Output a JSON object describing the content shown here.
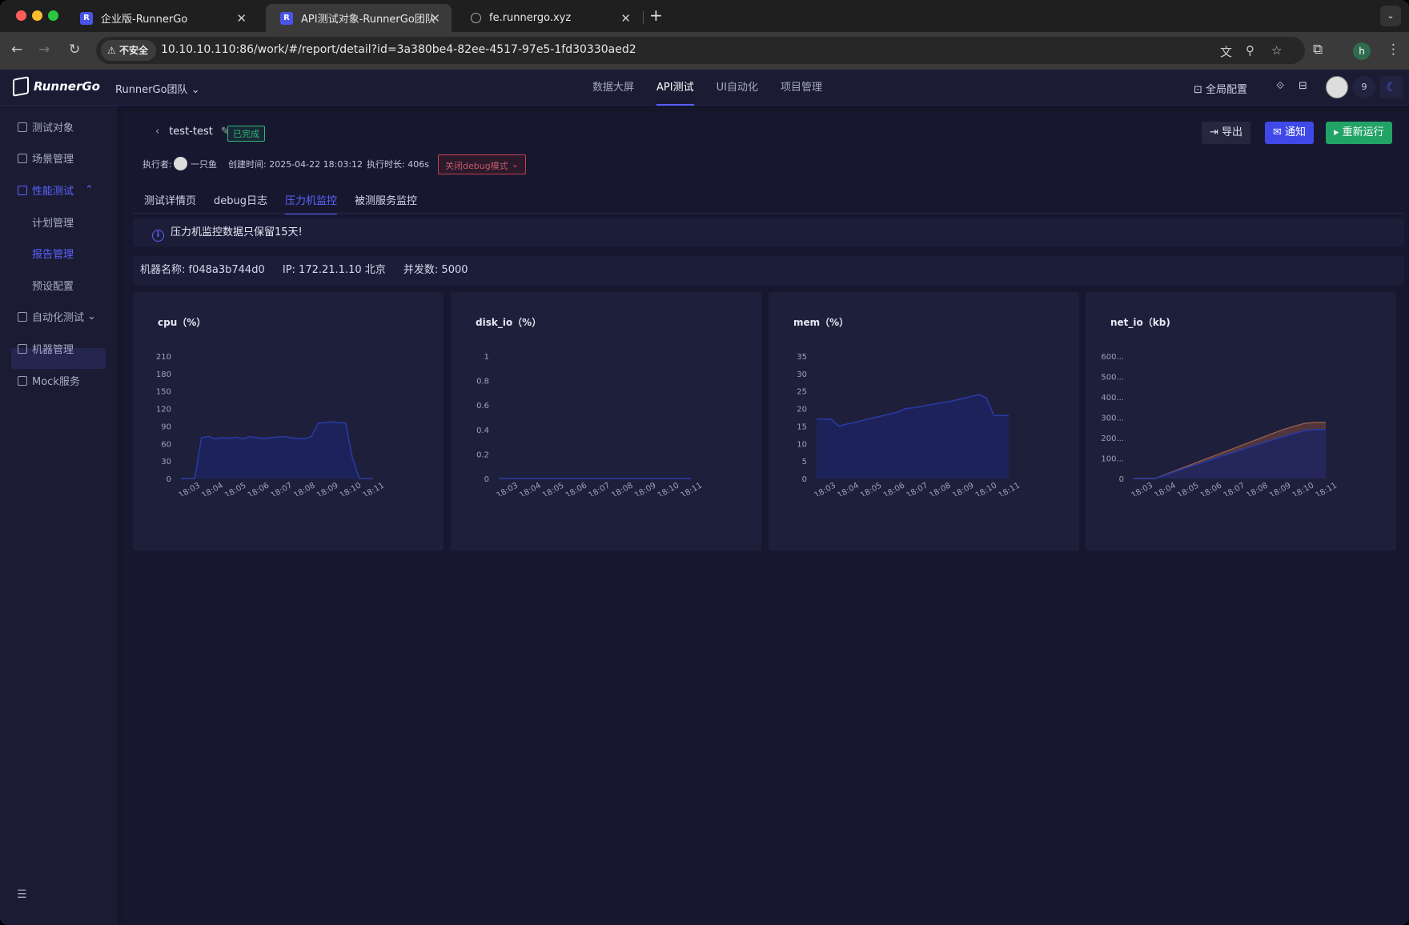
{
  "browser": {
    "tabs": [
      {
        "title": "企业版-RunnerGo",
        "active": false
      },
      {
        "title": "API测试对象-RunnerGo团队",
        "active": true
      },
      {
        "title": "fe.runnergo.xyz",
        "active": false
      }
    ],
    "insecure_label": "不安全",
    "url": "10.10.10.110:86/work/#/report/detail?id=3a380be4-82ee-4517-97e5-1fd30330aed2",
    "profile_initial": "h"
  },
  "app": {
    "logo": "RunnerGo",
    "team": "RunnerGo团队",
    "nav": [
      "数据大屏",
      "API测试",
      "UI自动化",
      "项目管理"
    ],
    "active_nav": "API测试",
    "global_config": "全局配置",
    "notification_count": "9"
  },
  "sidebar": {
    "items": [
      {
        "label": "测试对象"
      },
      {
        "label": "场景管理"
      },
      {
        "label": "性能测试"
      },
      {
        "label": "计划管理"
      },
      {
        "label": "报告管理"
      },
      {
        "label": "预设配置"
      },
      {
        "label": "自动化测试"
      },
      {
        "label": "机器管理"
      },
      {
        "label": "Mock服务"
      }
    ]
  },
  "report": {
    "name": "test-test",
    "status": "已完成",
    "executor_label": "执行者:",
    "executor": "一只鱼",
    "created": "创建时间: 2025-04-22 18:03:12",
    "duration": "执行时长: 406s",
    "debug_mode": "关闭debug模式",
    "buttons": {
      "export": "导出",
      "notify": "通知",
      "rerun": "重新运行"
    },
    "tabs": [
      "测试详情页",
      "debug日志",
      "压力机监控",
      "被测服务监控"
    ],
    "active_tab": "压力机监控",
    "notice": "压力机监控数据只保留15天!",
    "machine": {
      "name": "机器名称:  f048a3b744d0",
      "ip": "IP: 172.21.1.10 北京",
      "concurrency": "并发数: 5000"
    }
  },
  "colors": {
    "accent": "#5b63ff",
    "success": "#2eb872",
    "series_fill": "#1d2560",
    "series_line": "#2a3aa8",
    "net_out": "#5a3a3e"
  },
  "chart_data": [
    {
      "type": "area",
      "title": "cpu（%）",
      "x": [
        "18:03",
        "18:04",
        "18:05",
        "18:06",
        "18:07",
        "18:08",
        "18:09",
        "18:10",
        "18:11"
      ],
      "yticks": [
        "0",
        "30",
        "60",
        "90",
        "120",
        "150",
        "180",
        "210"
      ],
      "ylim": [
        0,
        210
      ],
      "series": [
        {
          "values": [
            0,
            0,
            0,
            70,
            72,
            68,
            70,
            69,
            71,
            68,
            72,
            70,
            69,
            70,
            71,
            72,
            70,
            69,
            68,
            72,
            95,
            96,
            97,
            96,
            95,
            35,
            0,
            0,
            0
          ]
        }
      ]
    },
    {
      "type": "area",
      "title": "disk_io（%）",
      "x": [
        "18:03",
        "18:04",
        "18:05",
        "18:06",
        "18:07",
        "18:08",
        "18:09",
        "18:10",
        "18:11"
      ],
      "yticks": [
        "0",
        "0.2",
        "0.4",
        "0.6",
        "0.8",
        "1"
      ],
      "ylim": [
        0,
        1
      ],
      "series": [
        {
          "values": [
            0,
            0,
            0,
            0,
            0,
            0,
            0,
            0,
            0,
            0,
            0,
            0,
            0,
            0,
            0,
            0,
            0,
            0,
            0,
            0,
            0,
            0,
            0,
            0,
            0,
            0,
            0,
            0,
            0
          ]
        }
      ]
    },
    {
      "type": "area",
      "title": "mem（%）",
      "x": [
        "18:03",
        "18:04",
        "18:05",
        "18:06",
        "18:07",
        "18:08",
        "18:09",
        "18:10",
        "18:11"
      ],
      "yticks": [
        "0",
        "5",
        "10",
        "15",
        "20",
        "25",
        "30",
        "35"
      ],
      "ylim": [
        0,
        35
      ],
      "series": [
        {
          "values": [
            17,
            17,
            17,
            15,
            15.5,
            16,
            16.5,
            17,
            17.5,
            18,
            18.5,
            19,
            20,
            20.2,
            20.5,
            21,
            21.3,
            21.7,
            22,
            22.5,
            23,
            23.5,
            24,
            23,
            18,
            18,
            18
          ]
        }
      ]
    },
    {
      "type": "area",
      "title": "net_io（kb)",
      "x": [
        "18:03",
        "18:04",
        "18:05",
        "18:06",
        "18:07",
        "18:08",
        "18:09",
        "18:10",
        "18:11"
      ],
      "yticks": [
        "0",
        "100...",
        "200...",
        "300...",
        "400...",
        "500...",
        "600..."
      ],
      "ylim": [
        0,
        600
      ],
      "series": [
        {
          "values": [
            0,
            0,
            0,
            20,
            40,
            60,
            80,
            100,
            120,
            140,
            160,
            180,
            200,
            220,
            240,
            255,
            270,
            275,
            275
          ]
        },
        {
          "values": [
            0,
            0,
            0,
            18,
            36,
            54,
            70,
            88,
            106,
            122,
            140,
            156,
            172,
            190,
            205,
            220,
            235,
            240,
            240
          ]
        }
      ]
    }
  ]
}
